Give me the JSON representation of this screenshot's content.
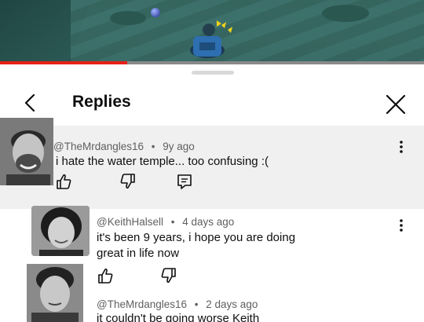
{
  "video": {
    "progress_fraction": 0.3
  },
  "sheet": {
    "title": "Replies",
    "icons": {
      "back": "chevron-left-icon",
      "close": "close-icon",
      "more": "kebab-menu-icon",
      "like": "thumbs-up-icon",
      "dislike": "thumbs-down-icon",
      "reply": "reply-icon"
    }
  },
  "comments": [
    {
      "author": "@TheMrdangles16",
      "sep": "•",
      "time": "9y ago",
      "text": "i hate the water temple... too confusing :("
    },
    {
      "author": "@KeithHalsell",
      "sep": "•",
      "time": "4 days ago",
      "text_line1": "it's been 9 years, i hope you are doing",
      "text_line2": "great in life now"
    },
    {
      "author": "@TheMrdangles16",
      "sep": "•",
      "time": "2 days ago",
      "text": "it couldn't be going worse Keith"
    }
  ],
  "colors": {
    "accent": "#e62117",
    "parent_bg": "#f0f0f0",
    "meta": "#606060"
  }
}
